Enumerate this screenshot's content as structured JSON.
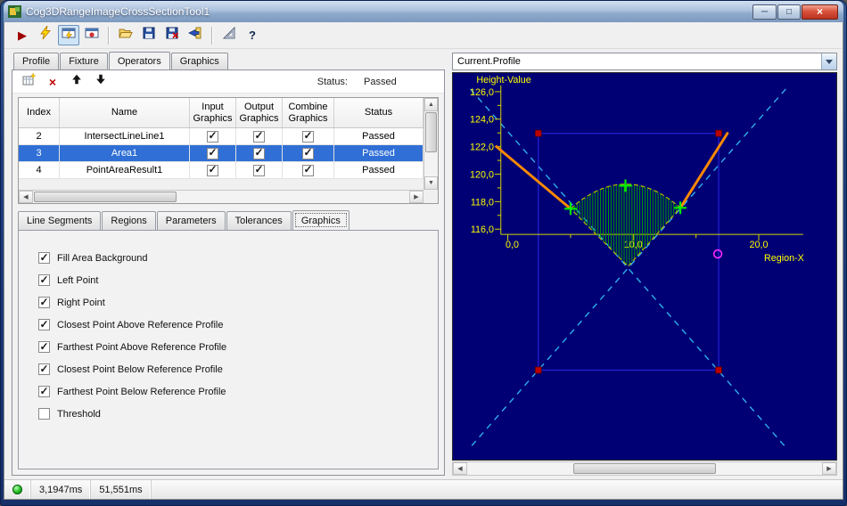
{
  "window": {
    "title": "Cog3DRangeImageCrossSectionTool1",
    "controls": {
      "minimize": "─",
      "maximize": "□",
      "close": "×"
    }
  },
  "toolbar": {
    "run_glyph": "▶",
    "help_glyph": "?",
    "buttons": [
      {
        "name": "run"
      },
      {
        "name": "electric-run"
      },
      {
        "name": "tool-display",
        "pressed": true
      },
      {
        "name": "result-display"
      },
      {
        "name": "open"
      },
      {
        "name": "save"
      },
      {
        "name": "save-record"
      },
      {
        "name": "import"
      },
      {
        "name": "measure"
      },
      {
        "name": "help"
      }
    ]
  },
  "tabs": {
    "items": [
      {
        "label": "Profile",
        "active": false
      },
      {
        "label": "Fixture",
        "active": false
      },
      {
        "label": "Operators",
        "active": true
      },
      {
        "label": "Graphics",
        "active": false
      }
    ]
  },
  "operators": {
    "toolbar": {
      "delete_glyph": "×",
      "status_label": "Status:",
      "status_value": "Passed"
    },
    "grid": {
      "columns": [
        "Index",
        "Name",
        "Input\nGraphics",
        "Output\nGraphics",
        "Combine\nGraphics",
        "Status"
      ],
      "rows": [
        {
          "index": "2",
          "name": "IntersectLineLine1",
          "input_graphics": true,
          "output_graphics": true,
          "combine_graphics": true,
          "status": "Passed",
          "selected": false
        },
        {
          "index": "3",
          "name": "Area1",
          "input_graphics": true,
          "output_graphics": true,
          "combine_graphics": true,
          "status": "Passed",
          "selected": true
        },
        {
          "index": "4",
          "name": "PointAreaResult1",
          "input_graphics": true,
          "output_graphics": true,
          "combine_graphics": true,
          "status": "Passed",
          "selected": false
        }
      ]
    },
    "sub_tabs": {
      "items": [
        {
          "label": "Line Segments",
          "active": false
        },
        {
          "label": "Regions",
          "active": false
        },
        {
          "label": "Parameters",
          "active": false
        },
        {
          "label": "Tolerances",
          "active": false
        },
        {
          "label": "Graphics",
          "active": true
        }
      ]
    },
    "graphics_options": [
      {
        "label": "Fill Area Background",
        "checked": true
      },
      {
        "label": "Left Point",
        "checked": true
      },
      {
        "label": "Right Point",
        "checked": true
      },
      {
        "label": "Closest Point Above Reference Profile",
        "checked": true
      },
      {
        "label": "Farthest Point Above Reference Profile",
        "checked": true
      },
      {
        "label": "Closest Point Below Reference Profile",
        "checked": true
      },
      {
        "label": "Farthest Point Below Reference Profile",
        "checked": true
      },
      {
        "label": "Threshold",
        "checked": false
      }
    ]
  },
  "profile_panel": {
    "selector_value": "Current.Profile",
    "plot": {
      "y_axis_label": "Height-Value",
      "x_axis_label": "Region-X",
      "y_ticks": [
        "126,0",
        "124,0",
        "122,0",
        "120,0",
        "118,0",
        "116,0"
      ],
      "x_ticks": [
        "0,0",
        "10,0",
        "20,0"
      ]
    }
  },
  "status_bar": {
    "time1": "3,1947ms",
    "time2": "51,551ms"
  },
  "icons": {
    "scroll_up": "▲",
    "scroll_down": "▼",
    "scroll_left": "◀",
    "scroll_right": "▶"
  },
  "colors": {
    "selection": "#2f6fd6",
    "plot_bg": "#000074",
    "profile": "#ff8a00",
    "hatch": "#00a000",
    "area_outline": "#b9b900",
    "cross_marker": "#00ee00",
    "region_box": "#2323dd",
    "diagonal": "#2fb0ee",
    "corner_marker": "#bb0000",
    "circle_marker": "#ff2aff",
    "axis": "#d6d600",
    "axis_label": "#ffff00",
    "status_led": "#1fbf1f"
  },
  "chart_data": {
    "type": "line",
    "title": "Current.Profile",
    "xlabel": "Region-X",
    "ylabel": "Height-Value",
    "xlim": [
      0,
      20
    ],
    "ylim": [
      116,
      126
    ],
    "x_tick_values": [
      0,
      10,
      20
    ],
    "y_tick_values": [
      126,
      124,
      122,
      120,
      118,
      116
    ],
    "series": [
      {
        "name": "cross-section-profile",
        "color": "#ff8a00",
        "x": [
          -0.9,
          5.0,
          9.6,
          13.8,
          17.5
        ],
        "y": [
          122.0,
          117.4,
          113.2,
          117.5,
          122.9
        ]
      }
    ],
    "markers": [
      {
        "name": "left-point",
        "x": 5.0,
        "y": 117.4,
        "shape": "cross",
        "color": "#00ee00"
      },
      {
        "name": "farthest-point-above-reference",
        "x": 9.4,
        "y": 119.1,
        "shape": "cross",
        "color": "#00ee00"
      },
      {
        "name": "right-point",
        "x": 13.8,
        "y": 117.5,
        "shape": "cross",
        "color": "#00ee00"
      },
      {
        "name": "threshold-point",
        "x": 16.7,
        "y": 114.1,
        "shape": "circle",
        "color": "#ff2aff"
      }
    ],
    "annotations": [
      "green vertical-hatched area between profile V and reference arc",
      "cyan dashed diagonal cross over search region",
      "dark blue search region rectangle with red corner handles"
    ]
  }
}
